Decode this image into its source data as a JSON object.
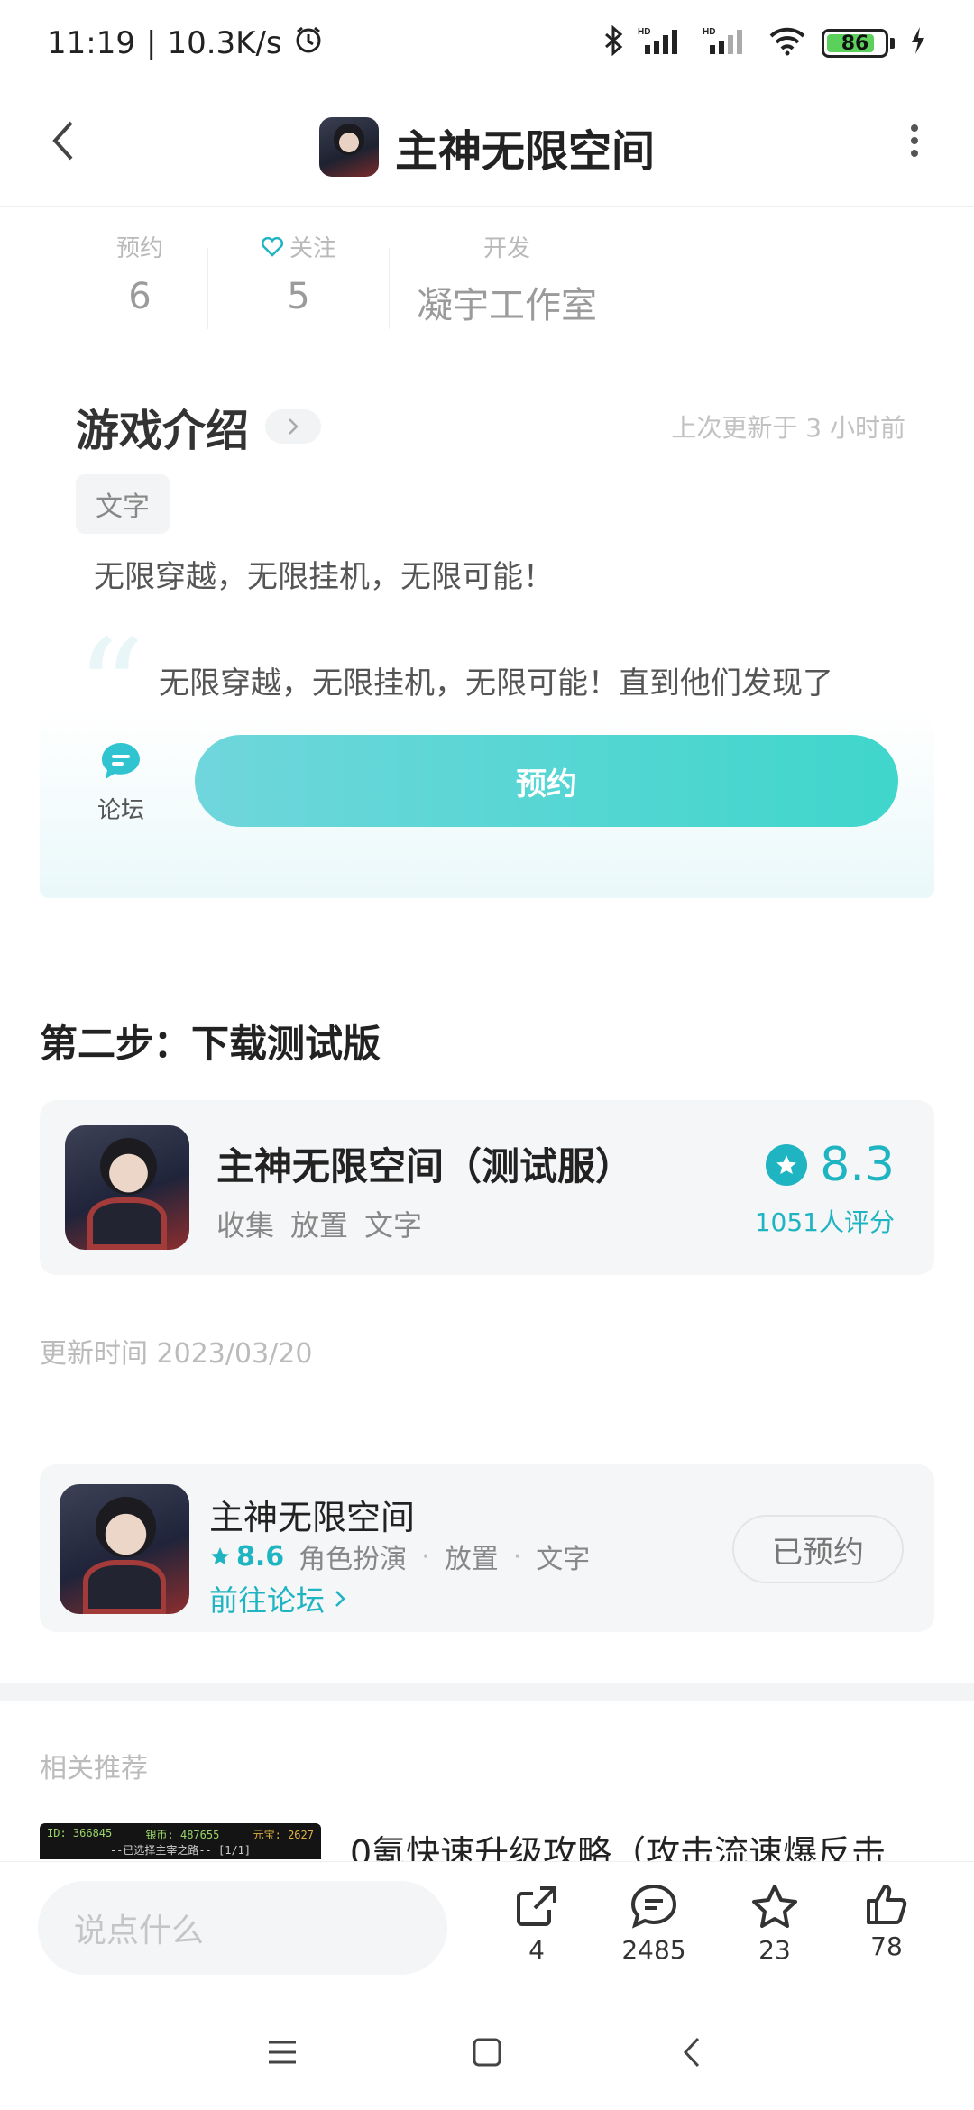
{
  "status_bar": {
    "time": "11:19",
    "network_speed": "10.3K/s",
    "battery": 86,
    "battery_label": "86",
    "signal_label_1": "HD",
    "signal_label_2": "HD"
  },
  "header": {
    "title": "主神无限空间"
  },
  "stats": [
    {
      "label": "预约",
      "value": "6"
    },
    {
      "label": "关注",
      "value": "5"
    },
    {
      "label": "开发",
      "value": "凝宇工作室"
    }
  ],
  "intro": {
    "title": "游戏介绍",
    "updated": "上次更新于 3 小时前",
    "tag": "文字",
    "line1": "无限穿越，无限挂机，无限可能！",
    "line2": "无限穿越，无限挂机，无限可能！直到他们发现了"
  },
  "reserve_bar": {
    "forum_label": "论坛",
    "reserve_label": "预约"
  },
  "step2": {
    "title": "第二步：下载测试版",
    "game_name": "主神无限空间（测试服）",
    "tags": [
      "收集",
      "放置",
      "文字"
    ],
    "rating": "8.3",
    "rating_count": "1051人评分",
    "update_time": "更新时间 2023/03/20"
  },
  "game_card": {
    "name": "主神无限空间",
    "score": "8.6",
    "tags": [
      "角色扮演",
      "放置",
      "文字"
    ],
    "forum_link": "前往论坛",
    "reserved_label": "已预约"
  },
  "related": {
    "title": "相关推荐",
    "item_text": "0氪快速升级攻略（攻击流速爆反击",
    "thumb_id": "ID: 366845",
    "thumb_coin": "银币: 487655",
    "thumb_yuanbao": "元宝: 2627",
    "thumb_line": "--已选择主宰之路-- [1/1]"
  },
  "bottom_bar": {
    "placeholder": "说点什么",
    "share_count": "4",
    "comment_count": "2485",
    "fav_count": "23",
    "like_count": "78"
  },
  "colors": {
    "accent": "#1fb4c2",
    "reserve_gradient_start": "#6fd6dc",
    "reserve_gradient_end": "#3fd6cc"
  }
}
